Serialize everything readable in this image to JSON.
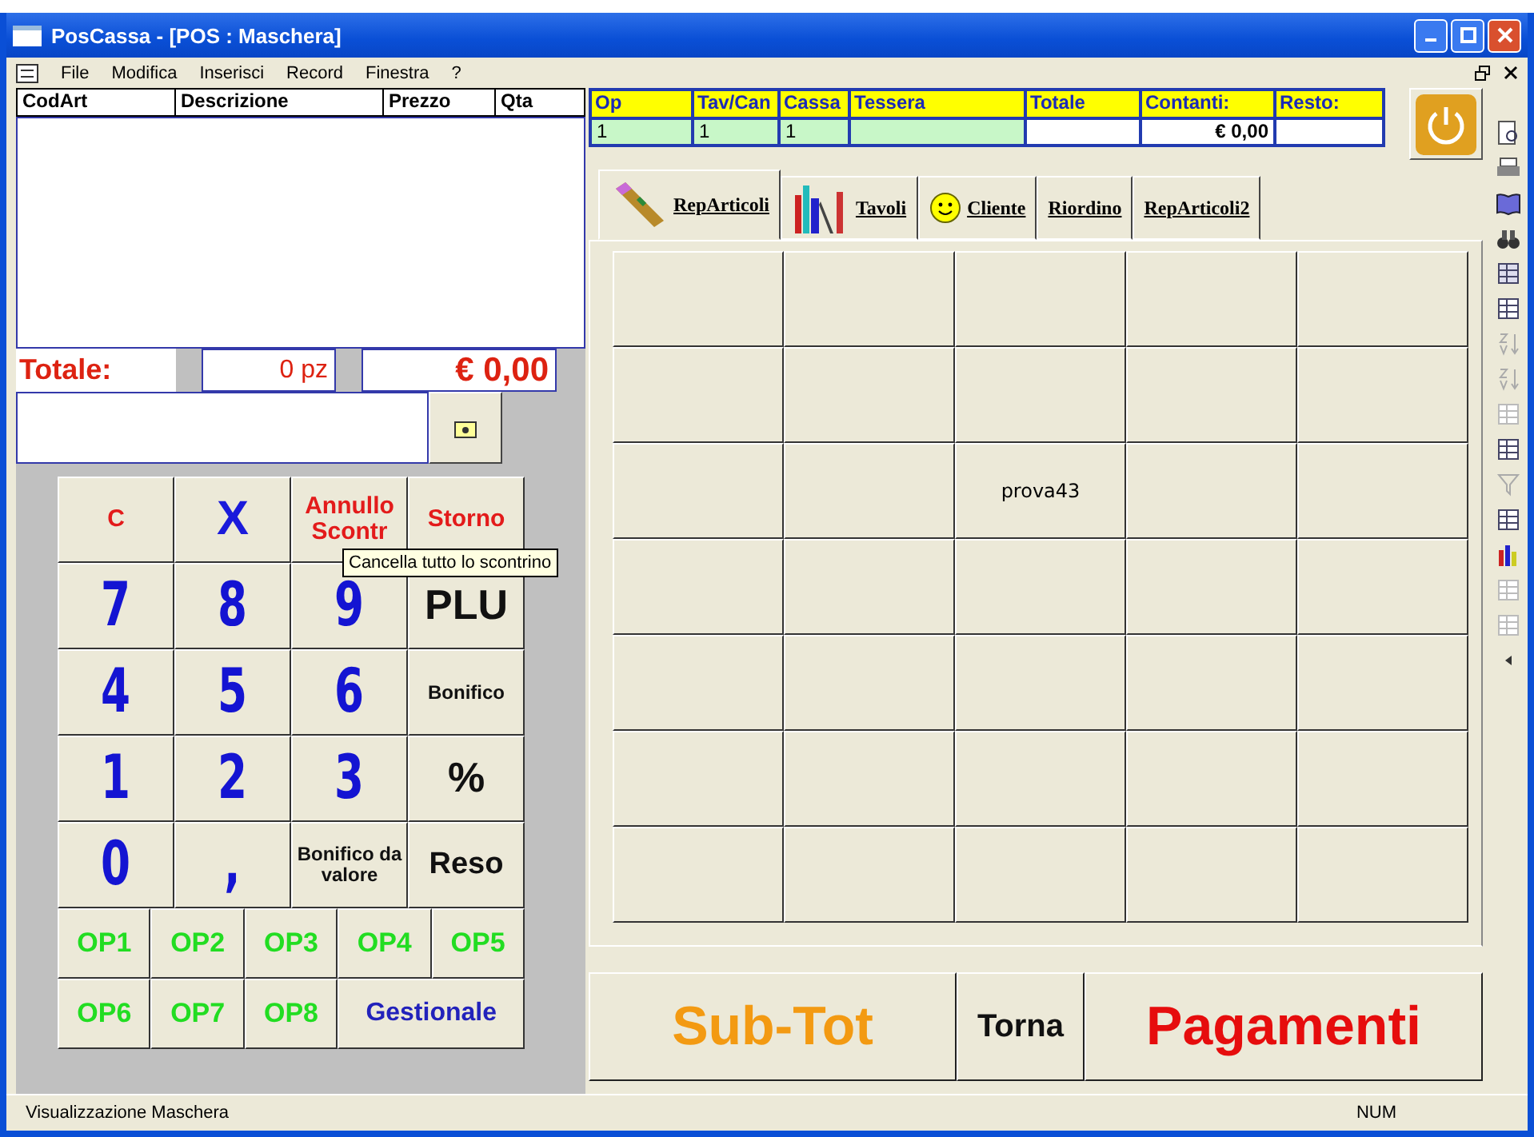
{
  "window": {
    "title": "PosCassa - [POS : Maschera]"
  },
  "menu": [
    "File",
    "Modifica",
    "Inserisci",
    "Record",
    "Finestra",
    "?"
  ],
  "order_table": {
    "columns": [
      "CodArt",
      "Descrizione",
      "Prezzo",
      "Qta"
    ]
  },
  "totals": {
    "label": "Totale:",
    "pieces": "0 pz",
    "amount": "€ 0,00"
  },
  "keypad": [
    {
      "label": "C",
      "kind": "action"
    },
    {
      "label": "X",
      "kind": "cancel"
    },
    {
      "label": "Annullo Scontr",
      "kind": "action"
    },
    {
      "label": "Storno",
      "kind": "action"
    },
    {
      "label": "7",
      "kind": "digit"
    },
    {
      "label": "8",
      "kind": "digit"
    },
    {
      "label": "9",
      "kind": "digit"
    },
    {
      "label": "PLU",
      "kind": "big"
    },
    {
      "label": "4",
      "kind": "digit"
    },
    {
      "label": "5",
      "kind": "digit"
    },
    {
      "label": "6",
      "kind": "digit"
    },
    {
      "label": "Bonifico",
      "kind": "small"
    },
    {
      "label": "1",
      "kind": "digit"
    },
    {
      "label": "2",
      "kind": "digit"
    },
    {
      "label": "3",
      "kind": "digit"
    },
    {
      "label": "%",
      "kind": "big"
    },
    {
      "label": "0",
      "kind": "digit"
    },
    {
      "label": ",",
      "kind": "digit"
    },
    {
      "label": "Bonifico da valore",
      "kind": "small"
    },
    {
      "label": "Reso",
      "kind": "medium"
    }
  ],
  "operators": [
    {
      "label": "OP1",
      "kind": "operator"
    },
    {
      "label": "OP2",
      "kind": "operator"
    },
    {
      "label": "OP3",
      "kind": "operator"
    },
    {
      "label": "OP4",
      "kind": "operator"
    },
    {
      "label": "OP5",
      "kind": "operator"
    },
    {
      "label": "OP6",
      "kind": "operator"
    },
    {
      "label": "OP7",
      "kind": "operator"
    },
    {
      "label": "OP8",
      "kind": "operator"
    },
    {
      "label": "Gestionale",
      "kind": "wide"
    }
  ],
  "tooltip": "Cancella tutto lo scontrino",
  "info_grid": [
    {
      "header": "Op",
      "value": "1",
      "kind": "green"
    },
    {
      "header": "Tav/Can",
      "value": "1",
      "kind": "green"
    },
    {
      "header": "Cassa",
      "value": "1",
      "kind": "green"
    },
    {
      "header": "Tessera",
      "kind": "green"
    },
    {
      "header": "Totale",
      "kind": "white"
    },
    {
      "header": "Contanti:",
      "value": "€ 0,00",
      "kind": "white"
    },
    {
      "header": "Resto:",
      "kind": "white"
    }
  ],
  "tabs": [
    {
      "label": "RepArticoli",
      "selected": true
    },
    {
      "label": "Tavoli",
      "selected": false
    },
    {
      "label": "Cliente",
      "selected": false
    },
    {
      "label": "Riordino",
      "selected": false
    },
    {
      "label": "RepArticoli2",
      "selected": false
    }
  ],
  "product_buttons": [
    {
      "kind": "blank"
    },
    {
      "kind": "blank"
    },
    {
      "kind": "blank"
    },
    {
      "kind": "blank"
    },
    {
      "kind": "blank"
    },
    {
      "kind": "blank"
    },
    {
      "kind": "blank"
    },
    {
      "kind": "blank"
    },
    {
      "kind": "blank"
    },
    {
      "kind": "blank"
    },
    {
      "kind": "blank"
    },
    {
      "kind": "blank"
    },
    {
      "kind": "item",
      "label": "prova43"
    },
    {
      "kind": "blank"
    },
    {
      "kind": "blank"
    },
    {
      "kind": "blank"
    },
    {
      "kind": "blank"
    },
    {
      "kind": "blank"
    },
    {
      "kind": "blank"
    },
    {
      "kind": "blank"
    },
    {
      "kind": "blank"
    },
    {
      "kind": "blank"
    },
    {
      "kind": "blank"
    },
    {
      "kind": "blank"
    },
    {
      "kind": "blank"
    },
    {
      "kind": "blank"
    },
    {
      "kind": "blank"
    },
    {
      "kind": "blank"
    },
    {
      "kind": "blank"
    },
    {
      "kind": "blank"
    },
    {
      "kind": "blank"
    },
    {
      "kind": "blank"
    },
    {
      "kind": "blank"
    },
    {
      "kind": "blank"
    },
    {
      "kind": "blank"
    }
  ],
  "bottom_buttons": [
    {
      "label": "Sub-Tot",
      "kind": "subtotal"
    },
    {
      "label": "Torna",
      "kind": "back"
    },
    {
      "label": "Pagamenti",
      "kind": "pay"
    }
  ],
  "status_bar": {
    "text": "Visualizzazione Maschera",
    "indicator": "NUM"
  }
}
